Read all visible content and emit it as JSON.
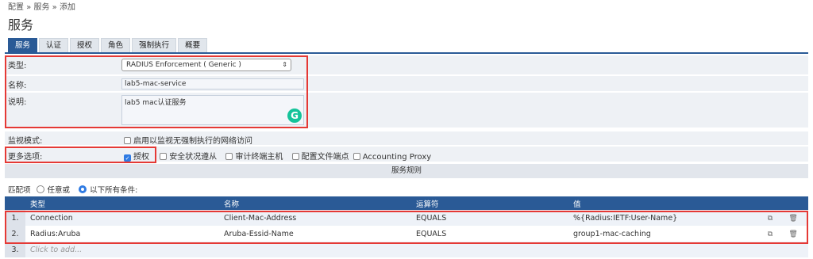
{
  "breadcrumb": "配置 » 服务 » 添加",
  "title": "服务",
  "tabs": [
    {
      "label": "服务",
      "active": true
    },
    {
      "label": "认证",
      "active": false
    },
    {
      "label": "授权",
      "active": false
    },
    {
      "label": "角色",
      "active": false
    },
    {
      "label": "强制执行",
      "active": false
    },
    {
      "label": "概要",
      "active": false
    }
  ],
  "form": {
    "type_label": "类型:",
    "type_value": "RADIUS Enforcement ( Generic )",
    "name_label": "名称:",
    "name_value": "lab5-mac-service",
    "desc_label": "说明:",
    "desc_value": "lab5 mac认证服务",
    "monitor_label": "监视模式:",
    "monitor_option": "启用以监视无强制执行的网络访问",
    "more_label": "更多选项:",
    "more_options": [
      {
        "label": "授权",
        "checked": true
      },
      {
        "label": "安全状况遵从",
        "checked": false
      },
      {
        "label": "审计终端主机",
        "checked": false
      },
      {
        "label": "配置文件端点",
        "checked": false
      },
      {
        "label": "Accounting Proxy",
        "checked": false
      }
    ]
  },
  "rules": {
    "header": "服务规则",
    "match_label": "匹配项",
    "match_any": "任意或",
    "match_all": "以下所有条件:",
    "match_selected": "all",
    "columns": [
      "类型",
      "名称",
      "运算符",
      "值"
    ],
    "rows": [
      {
        "num": "1.",
        "type": "Connection",
        "name": "Client-Mac-Address",
        "operator": "EQUALS",
        "value": "%{Radius:IETF:User-Name}"
      },
      {
        "num": "2.",
        "type": "Radius:Aruba",
        "name": "Aruba-Essid-Name",
        "operator": "EQUALS",
        "value": "group1-mac-caching"
      }
    ],
    "add_row": {
      "num": "3.",
      "text": "Click to add..."
    }
  },
  "colors": {
    "accent": "#2a5a96",
    "highlight_box": "#e53935",
    "checkbox_checked": "#2f7be3"
  }
}
